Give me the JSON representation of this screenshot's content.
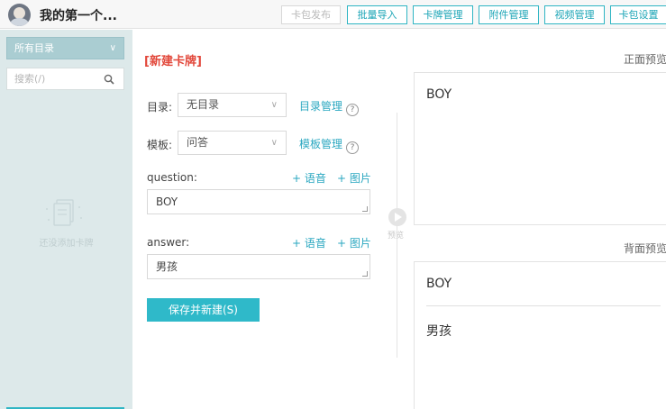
{
  "header": {
    "title": "我的第一个...",
    "buttons": [
      {
        "label": "卡包发布",
        "disabled": true
      },
      {
        "label": "批量导入",
        "disabled": false
      },
      {
        "label": "卡牌管理",
        "disabled": false
      },
      {
        "label": "附件管理",
        "disabled": false
      },
      {
        "label": "视频管理",
        "disabled": false
      },
      {
        "label": "卡包设置",
        "disabled": false
      }
    ]
  },
  "sidebar": {
    "directory": "所有目录",
    "search_placeholder": "搜索(/)",
    "empty_text": "还没添加卡牌"
  },
  "editor": {
    "title": "[新建卡牌]",
    "directory_label": "目录:",
    "directory_value": "无目录",
    "directory_manage": "目录管理",
    "template_label": "模板:",
    "template_value": "问答",
    "template_manage": "模板管理",
    "help_glyph": "?",
    "add_audio": "+ 语音",
    "add_image": "+ 图片",
    "question_label": "question:",
    "question_value": "BOY",
    "answer_label": "answer:",
    "answer_value": "男孩",
    "save_label": "保存并新建(S)"
  },
  "preview": {
    "toggle_label": "预览",
    "front_heading": "正面预览",
    "back_heading": "背面预览",
    "front_text": "BOY",
    "back_question": "BOY",
    "back_answer": "男孩"
  },
  "colors": {
    "accent": "#2fb5c4",
    "title_red": "#e2473a",
    "sidebar_bg": "#dde9ea"
  }
}
